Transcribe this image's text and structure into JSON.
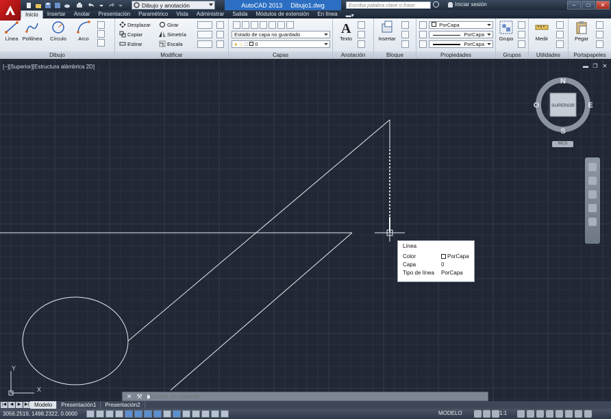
{
  "titlebar": {
    "workspace": "Dibujo y anotación",
    "app_name": "AutoCAD 2013",
    "document": "Dibujo1.dwg",
    "search_placeholder": "Escriba palabra clave o frase",
    "signin": "Iniciar sesión"
  },
  "ribbon_tabs": [
    "Inicio",
    "Insertar",
    "Anotar",
    "Presentación",
    "Paramétrico",
    "Vista",
    "Administrar",
    "Salida",
    "Módulos de extensión",
    "En línea"
  ],
  "panels": {
    "dibujo": {
      "label": "Dibujo",
      "tools": [
        "Línea",
        "Polilínea",
        "Círculo",
        "Arco"
      ]
    },
    "modificar": {
      "label": "Modificar",
      "tools": [
        "Desplazar",
        "Girar",
        "Copiar",
        "Simetría",
        "Estirar",
        "Escala"
      ]
    },
    "capas": {
      "label": "Capas",
      "layer_state": "Estado de capa no guardado",
      "current_layer": "0"
    },
    "anotacion": {
      "label": "Anotación",
      "tool": "Texto"
    },
    "bloque": {
      "label": "Bloque",
      "tool": "Insertar"
    },
    "propiedades": {
      "label": "Propiedades",
      "color": "PorCapa",
      "linetype": "PorCapa",
      "lineweight": "PorCapa"
    },
    "grupos": {
      "label": "Grupos",
      "tool": "Grupo"
    },
    "utilidades": {
      "label": "Utilidades",
      "tool": "Medir"
    },
    "portapapeles": {
      "label": "Portapapeles",
      "tool": "Pegar"
    }
  },
  "viewport": {
    "label": "[−][Superior][Estructura alámbrica 2D]",
    "viewcube": {
      "face": "SUPERIOR",
      "n": "N",
      "s": "S",
      "e": "E",
      "w": "O"
    },
    "wcs": "WCS"
  },
  "tooltip": {
    "title": "Línea",
    "rows": [
      {
        "key": "Color",
        "value": "PorCapa"
      },
      {
        "key": "Capa",
        "value": "0"
      },
      {
        "key": "Tipo de línea",
        "value": "PorCapa"
      }
    ]
  },
  "command": {
    "placeholder": "Escribir un comando"
  },
  "ucs": {
    "x": "X",
    "y": "Y"
  },
  "layout_tabs": [
    "Modelo",
    "Presentación1",
    "Presentación2"
  ],
  "statusbar": {
    "coords": "3056.2519, 1498.2322, 0.0000",
    "model": "MODELO",
    "scale": "1:1"
  },
  "colors": {
    "viewport_bg": "#212735",
    "grid_minor": "#2a3140",
    "grid_major": "#333c4d",
    "geometry": "#e8ecf2",
    "accent_blue": "#2c6fc2",
    "logo_red": "#d62020"
  }
}
